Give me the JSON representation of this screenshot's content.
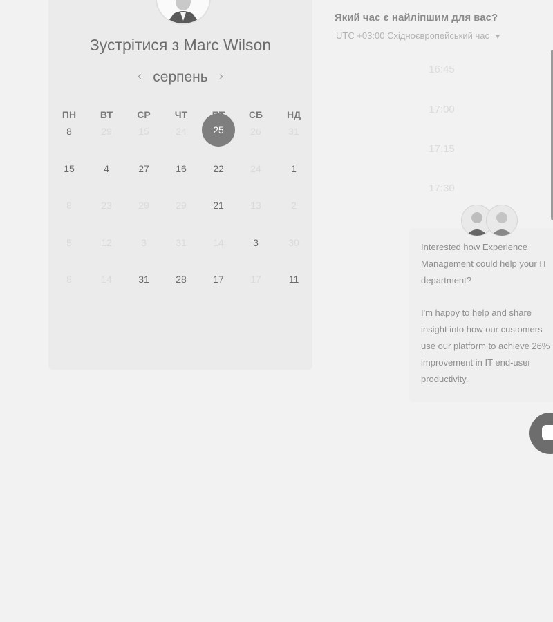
{
  "organizer": {
    "title": "Зустрітися з Marc Wilson"
  },
  "calendar": {
    "month": "серпень",
    "prev_icon": "chevron-left-icon",
    "next_icon": "chevron-right-icon",
    "weekdays": [
      "ПН",
      "ВТ",
      "СР",
      "ЧТ",
      "ПТ",
      "СБ",
      "НД"
    ],
    "selected_day": "25",
    "weeks": [
      [
        {
          "label": "8",
          "state": "on"
        },
        {
          "label": "29",
          "state": "off"
        },
        {
          "label": "15",
          "state": "off"
        },
        {
          "label": "24",
          "state": "off"
        },
        {
          "label": "25",
          "state": "selected"
        },
        {
          "label": "26",
          "state": "off"
        },
        {
          "label": "31",
          "state": "off"
        }
      ],
      [
        {
          "label": "15",
          "state": "on"
        },
        {
          "label": "4",
          "state": "on"
        },
        {
          "label": "27",
          "state": "on"
        },
        {
          "label": "16",
          "state": "on"
        },
        {
          "label": "22",
          "state": "on"
        },
        {
          "label": "24",
          "state": "off"
        },
        {
          "label": "1",
          "state": "on"
        }
      ],
      [
        {
          "label": "8",
          "state": "off"
        },
        {
          "label": "23",
          "state": "off"
        },
        {
          "label": "29",
          "state": "off"
        },
        {
          "label": "29",
          "state": "off"
        },
        {
          "label": "21",
          "state": "on"
        },
        {
          "label": "13",
          "state": "off"
        },
        {
          "label": "2",
          "state": "off"
        }
      ],
      [
        {
          "label": "5",
          "state": "off"
        },
        {
          "label": "12",
          "state": "off"
        },
        {
          "label": "3",
          "state": "off"
        },
        {
          "label": "31",
          "state": "off"
        },
        {
          "label": "14",
          "state": "off"
        },
        {
          "label": "3",
          "state": "on"
        },
        {
          "label": "30",
          "state": "off"
        }
      ],
      [
        {
          "label": "8",
          "state": "off"
        },
        {
          "label": "14",
          "state": "off"
        },
        {
          "label": "31",
          "state": "on"
        },
        {
          "label": "28",
          "state": "on"
        },
        {
          "label": "17",
          "state": "on"
        },
        {
          "label": "17",
          "state": "off"
        },
        {
          "label": "11",
          "state": "on"
        }
      ]
    ]
  },
  "scheduler": {
    "question": "Який час є найліпшим для вас?",
    "timezone": "UTC +03:00 Східноєвропейський час",
    "timezone_icon": "caret-down-icon",
    "slots": [
      "16:45",
      "17:00",
      "17:15",
      "17:30"
    ]
  },
  "chat": {
    "agent_icons": [
      "agent-avatar-icon",
      "agent-avatar-icon"
    ],
    "message_lines_1": [
      "Interested how Experience",
      "Management could help your IT",
      "department?"
    ],
    "message_lines_2": [
      "I'm happy to help and share",
      "insight into how our customers",
      "use our platform to achieve 26%",
      "improvement in IT end-user",
      "productivity."
    ],
    "launcher_icon": "chat-bubble-icon"
  },
  "colors": {
    "background": "#f2f2f2",
    "panel": "#ebebeb",
    "selected_day": "#7e7e7e",
    "launcher": "#6d6d6d"
  }
}
